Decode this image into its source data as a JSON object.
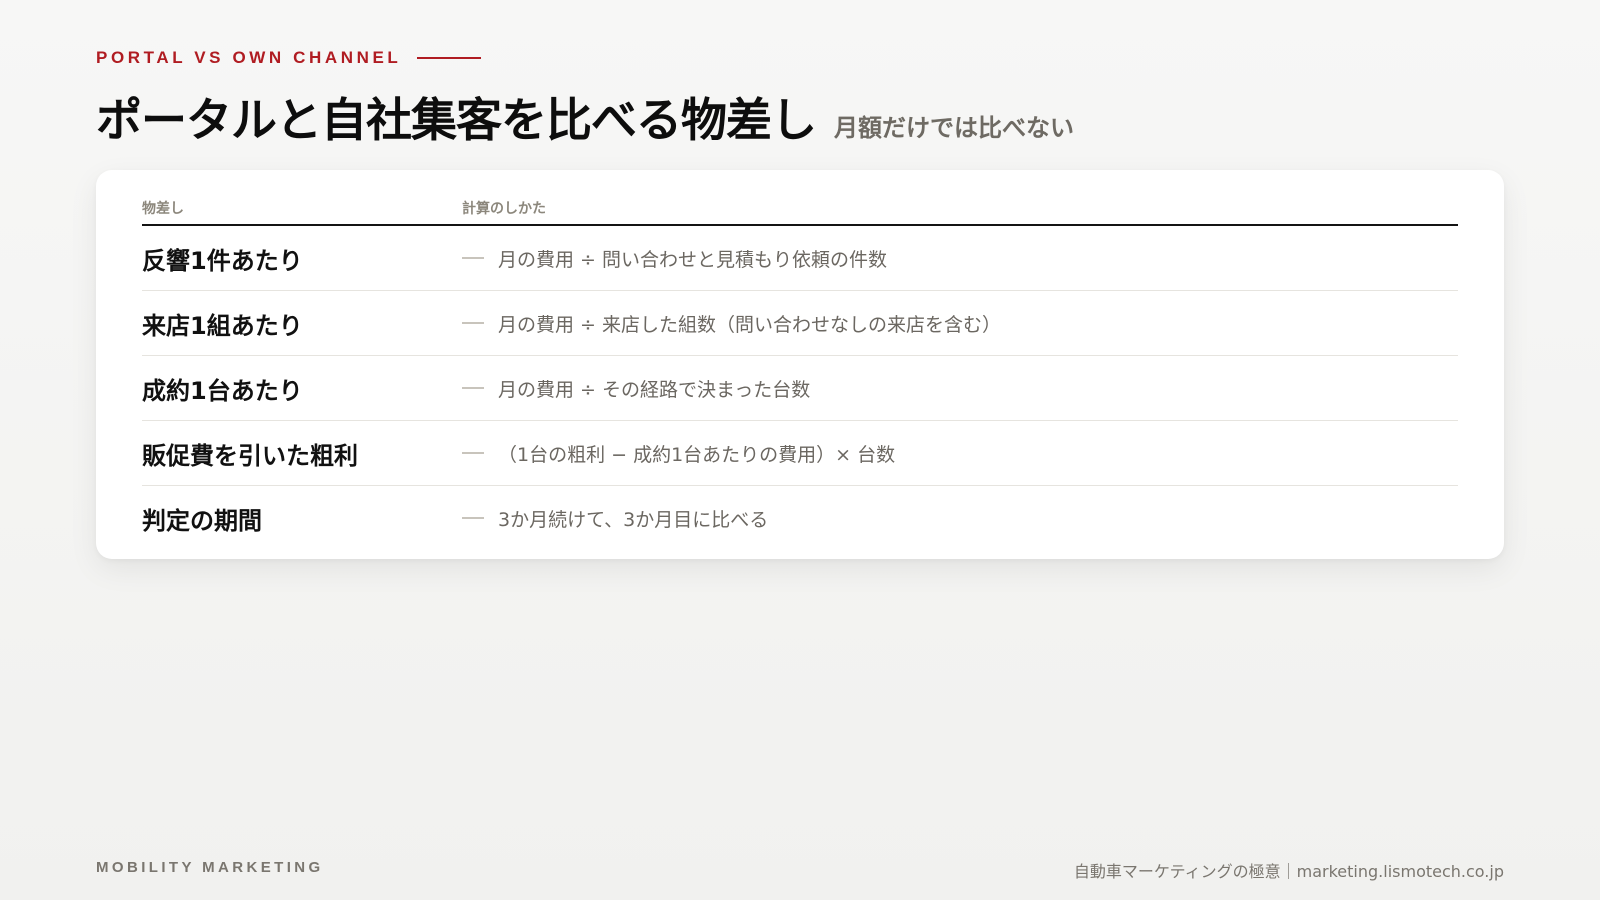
{
  "header": {
    "eyebrow": "PORTAL VS OWN CHANNEL",
    "title": "ポータルと自社集客を比べる物差し",
    "subtitle": "月額だけでは比べない"
  },
  "table": {
    "columns": [
      "物差し",
      "計算のしかた"
    ],
    "rows": [
      {
        "metric": "反響1件あたり",
        "formula": "月の費用 ÷ 問い合わせと見積もり依頼の件数"
      },
      {
        "metric": "来店1組あたり",
        "formula": "月の費用 ÷ 来店した組数（問い合わせなしの来店を含む）"
      },
      {
        "metric": "成約1台あたり",
        "formula": "月の費用 ÷ その経路で決まった台数"
      },
      {
        "metric": "販促費を引いた粗利",
        "formula": "（1台の粗利 − 成約1台あたりの費用）× 台数"
      },
      {
        "metric": "判定の期間",
        "formula": "3か月続けて、3か月目に比べる"
      }
    ]
  },
  "footer": {
    "brand": "MOBILITY MARKETING",
    "site": "自動車マーケティングの極意｜marketing.lismotech.co.jp"
  },
  "colors": {
    "accent": "#b01c22",
    "muted_text": "#6b6761",
    "heading": "#0d0d0d"
  }
}
